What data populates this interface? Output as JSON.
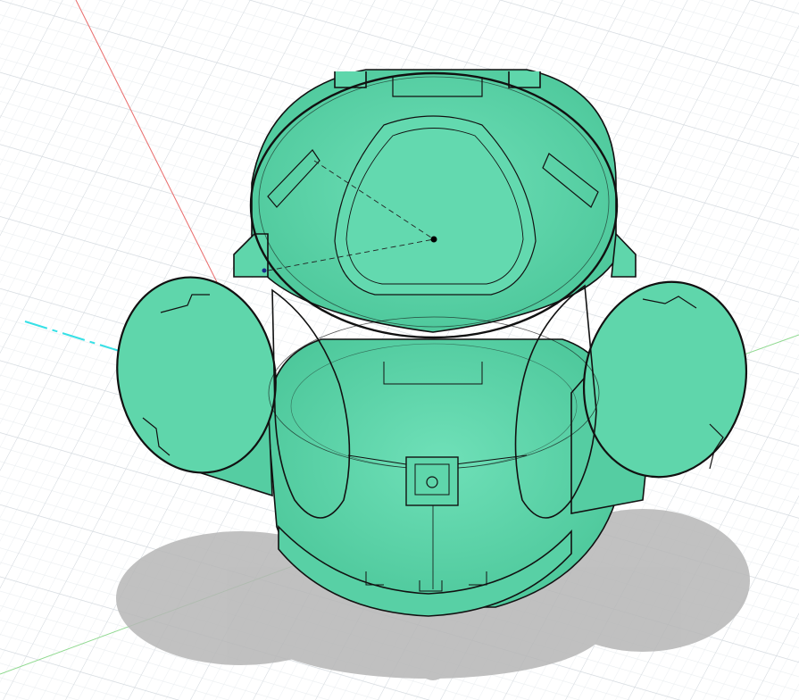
{
  "viewport": {
    "background": "#ffffff",
    "grid_color": "#d6dbe0",
    "grid_minor_color": "#e9edf0",
    "axis_x_color": "#e96b6b",
    "axis_z_color": "#8fd98f",
    "axis_y_color": "#37e0e6",
    "body_fill": "#5fd6ab",
    "body_edge": "#111111",
    "shadow_color": "#b9b9b9",
    "selection_point_icon": "sketch-point-icon"
  }
}
